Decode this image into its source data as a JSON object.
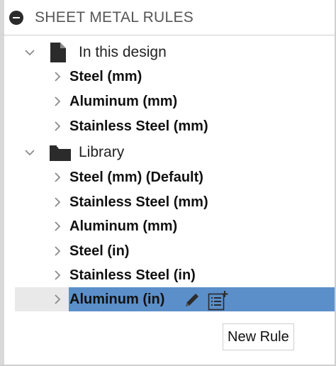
{
  "panel": {
    "title": "SHEET METAL RULES",
    "collapse_icon": "minus-circle-icon"
  },
  "groups": [
    {
      "label": "In this design",
      "icon": "document-icon",
      "expanded": true,
      "items": [
        {
          "label": "Steel (mm)"
        },
        {
          "label": "Aluminum (mm)"
        },
        {
          "label": "Stainless Steel (mm)"
        }
      ]
    },
    {
      "label": "Library",
      "icon": "folder-icon",
      "expanded": true,
      "items": [
        {
          "label": "Steel (mm) (Default)"
        },
        {
          "label": "Stainless Steel (mm)"
        },
        {
          "label": "Aluminum (mm)"
        },
        {
          "label": "Steel (in)"
        },
        {
          "label": "Stainless Steel (in)"
        },
        {
          "label": "Aluminum (in)",
          "selected": true
        }
      ]
    }
  ],
  "selected_row_actions": {
    "edit_icon": "pencil-icon",
    "new_rule_icon": "list-plus-icon"
  },
  "tooltip": {
    "text": "New Rule"
  },
  "colors": {
    "selection": "#5b8fca",
    "text": "#111111"
  }
}
